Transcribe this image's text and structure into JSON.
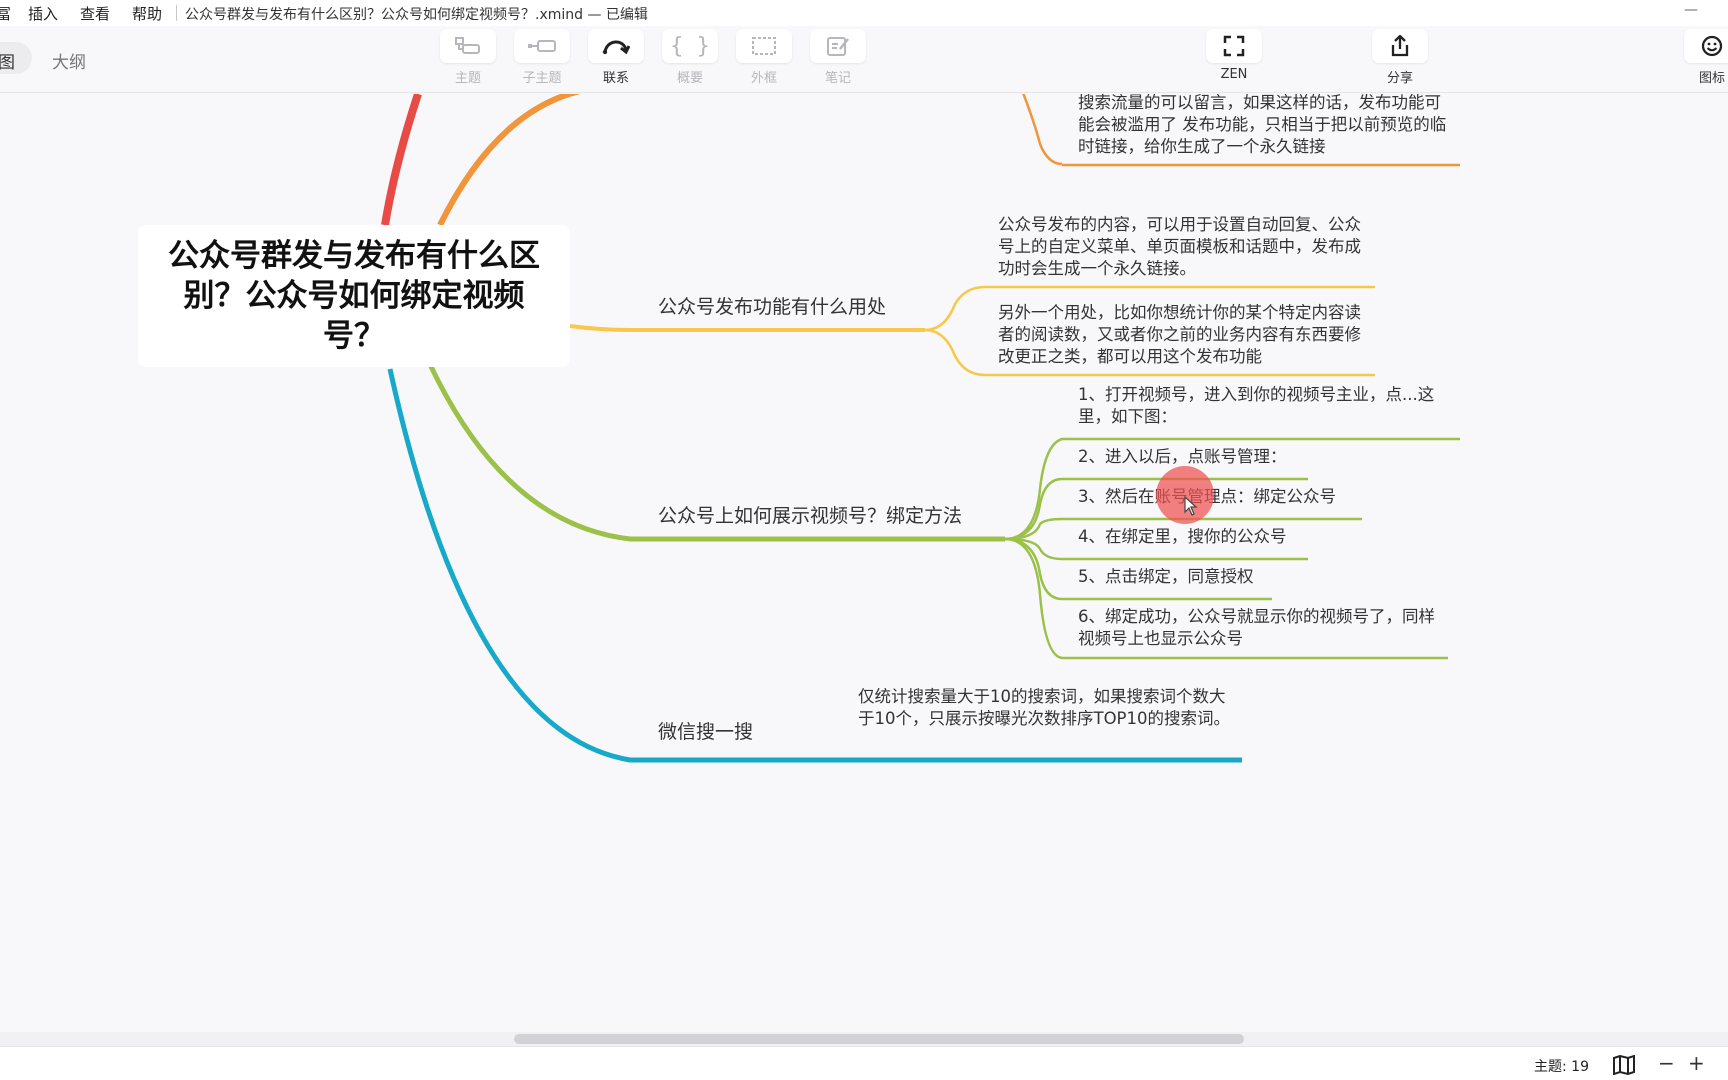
{
  "menu": {
    "items": [
      "冨",
      "插入",
      "查看",
      "帮助"
    ]
  },
  "window": {
    "title": "公众号群发与发布有什么区别？公众号如何绑定视频号？.xmind — 已编辑"
  },
  "view_toggle": {
    "map": "图",
    "outline": "大纲"
  },
  "toolbar": {
    "topic": "主题",
    "subtopic": "子主题",
    "relationship": "联系",
    "summary": "概要",
    "boundary": "外框",
    "notes": "笔记",
    "zen": "ZEN",
    "share": "分享",
    "icons": "图标"
  },
  "mindmap": {
    "central": "公众号群发与发布有什么区别？公众号如何绑定视频号？",
    "top_note": "搜索流量的可以留言，如果这样的话，发布功能可能会被滥用了 发布功能，只相当于把以前预览的临时链接，给你生成了一个永久链接",
    "branch_publish": {
      "title": "公众号发布功能有什么用处",
      "notes": [
        "公众号发布的内容，可以用于设置自动回复、公众号上的自定义菜单、单页面模板和话题中，发布成功时会生成一个永久链接。",
        "另外一个用处，比如你想统计你的某个特定内容读者的阅读数，又或者你之前的业务内容有东西要修改更正之类，都可以用这个发布功能"
      ]
    },
    "branch_bind": {
      "title": "公众号上如何展示视频号？绑定方法",
      "steps": [
        "1、打开视频号，进入到你的视频号主业，点...这里，如下图：",
        "2、进入以后，点账号管理：",
        "3、然后在账号管理点：绑定公众号",
        "4、在绑定里，搜你的公众号",
        "5、点击绑定，同意授权",
        "6、绑定成功，公众号就显示你的视频号了，同样视频号上也显示公众号"
      ]
    },
    "branch_search": {
      "title": "微信搜一搜",
      "note": "仅统计搜索量大于10的搜索词，如果搜索词个数大于10个，只展示按曝光次数排序TOP10的搜索词。"
    }
  },
  "status": {
    "topic_count": "主题: 19",
    "zoom_out": "−",
    "zoom_in": "+"
  },
  "colors": {
    "red": "#e84a45",
    "orange": "#f0953a",
    "yellow": "#f7c84a",
    "green": "#9bc149",
    "cyan": "#16a9c9"
  }
}
